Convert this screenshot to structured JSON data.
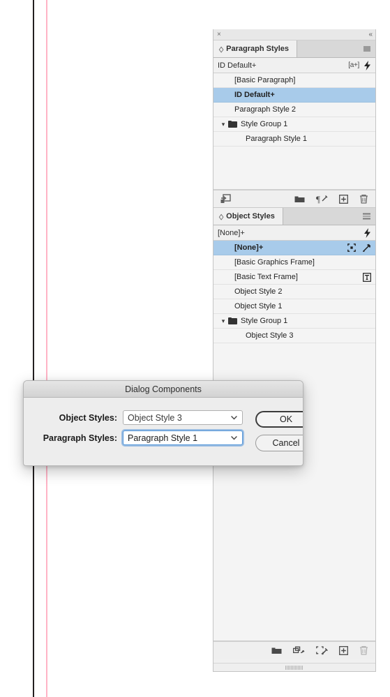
{
  "document": {
    "edge_color": "#231f20",
    "margin_guide_color": "#ffb3c6"
  },
  "panel_dock": {
    "close_label": "×",
    "collapse_label": "«",
    "paragraph_styles": {
      "tab_label": "Paragraph Styles",
      "menu_icon": "panel-menu-icon",
      "current_style": "ID Default+",
      "current_style_icons": [
        "[a+]",
        "quick-apply-bolt-icon"
      ],
      "rows": [
        {
          "label": "[Basic Paragraph]",
          "indent": 1,
          "selected": false,
          "type": "style"
        },
        {
          "label": "ID Default+",
          "indent": 1,
          "selected": true,
          "type": "style"
        },
        {
          "label": "Paragraph Style 2",
          "indent": 1,
          "selected": false,
          "type": "style"
        },
        {
          "label": "Style Group 1",
          "indent": 0,
          "selected": false,
          "type": "group"
        },
        {
          "label": "Paragraph Style 1",
          "indent": 2,
          "selected": false,
          "type": "style"
        }
      ],
      "footer_icons": [
        "load-paragraph-styles-icon",
        "new-style-group-icon",
        "clear-overrides-icon",
        "create-new-style-icon",
        "delete-style-icon"
      ]
    },
    "object_styles": {
      "tab_label": "Object Styles",
      "menu_icon": "panel-menu-icon",
      "current_style": "[None]+",
      "current_style_icons": [
        "quick-apply-bolt-icon"
      ],
      "rows": [
        {
          "label": "[None]+",
          "indent": 1,
          "selected": true,
          "type": "style",
          "icons": [
            "frame-attributes-icon",
            "clear-attributes-icon"
          ]
        },
        {
          "label": "[Basic Graphics Frame]",
          "indent": 1,
          "selected": false,
          "type": "style",
          "icons": []
        },
        {
          "label": "[Basic Text Frame]",
          "indent": 1,
          "selected": false,
          "type": "style",
          "icons": [
            "text-frame-icon"
          ]
        },
        {
          "label": "Object Style 2",
          "indent": 1,
          "selected": false,
          "type": "style",
          "icons": []
        },
        {
          "label": "Object Style 1",
          "indent": 1,
          "selected": false,
          "type": "style",
          "icons": []
        },
        {
          "label": "Style Group 1",
          "indent": 0,
          "selected": false,
          "type": "group",
          "icons": []
        },
        {
          "label": "Object Style 3",
          "indent": 2,
          "selected": false,
          "type": "style",
          "icons": []
        }
      ],
      "footer_icons": [
        "new-style-group-icon",
        "clear-overrides-icon",
        "clear-attributes-icon",
        "create-new-style-icon",
        "delete-style-icon"
      ]
    },
    "resize_grip": "panel-resize-grip"
  },
  "dialog": {
    "title": "Dialog Components",
    "fields": [
      {
        "label": "Object Styles:",
        "value": "Object Style 3",
        "focused": false
      },
      {
        "label": "Paragraph Styles:",
        "value": "Paragraph Style 1",
        "focused": true
      }
    ],
    "buttons": [
      {
        "label": "OK",
        "default": true
      },
      {
        "label": "Cancel",
        "default": false
      }
    ],
    "focus_ring_color": "#5596d8"
  }
}
